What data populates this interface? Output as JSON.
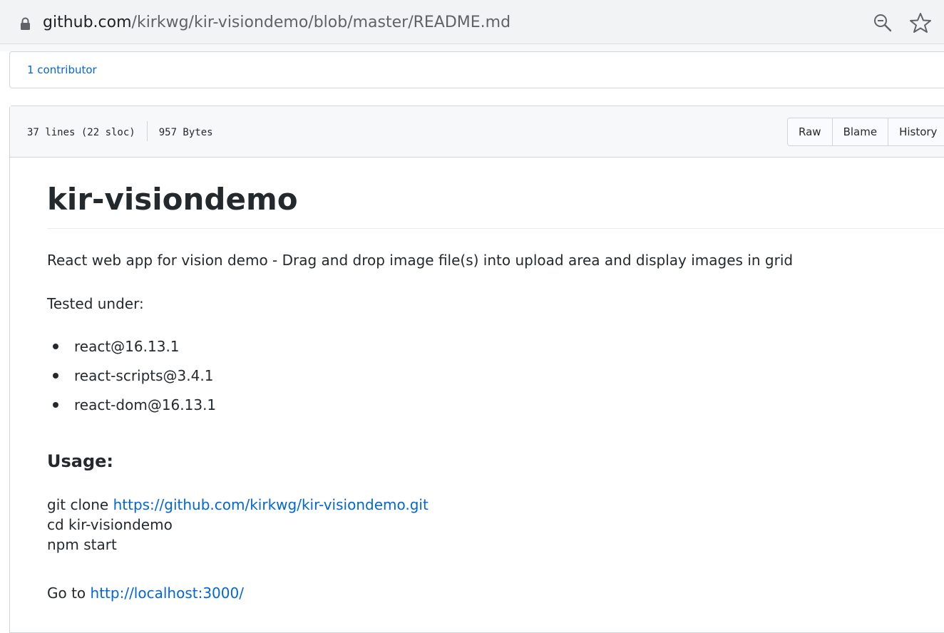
{
  "browser": {
    "url_host": "github.com",
    "url_path": "/kirkwg/kir-visiondemo/blob/master/README.md",
    "icons": [
      "lock-icon",
      "zoom-icon",
      "star-icon"
    ]
  },
  "repo": {
    "contributors_label": "1 contributor"
  },
  "file": {
    "lines_info": "37 lines (22 sloc)",
    "size_info": "957 Bytes",
    "buttons": {
      "raw": "Raw",
      "blame": "Blame",
      "history": "History"
    }
  },
  "readme": {
    "title": "kir-visiondemo",
    "description": "React web app for vision demo - Drag and drop image file(s) into upload area and display images in grid",
    "tested_under": "Tested under:",
    "deps": [
      "react@16.13.1",
      "react-scripts@3.4.1",
      "react-dom@16.13.1"
    ],
    "usage_heading": "Usage:",
    "clone_prefix": "git clone ",
    "clone_url": "https://github.com/kirkwg/kir-visiondemo.git",
    "cd_cmd": "cd kir-visiondemo",
    "start_cmd": "npm start",
    "goto_prefix": "Go to ",
    "goto_url": "http://localhost:3000/"
  },
  "colors": {
    "link": "#0366d6",
    "text": "#24292e",
    "border": "#d1d5da",
    "header_bg": "#f6f8fa"
  }
}
